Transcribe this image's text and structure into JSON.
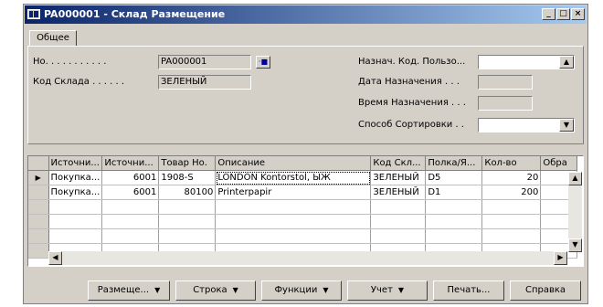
{
  "window": {
    "title": "PA000001 - Склад Размещение",
    "controls": [
      "_",
      "□",
      "×"
    ]
  },
  "tabs": [
    {
      "label": "Общее",
      "active": true
    }
  ],
  "form": {
    "no_label": "Но. . . . . . . . . . .",
    "no_value": "PA000001",
    "location_label": "Код Склада . . . . . .",
    "location_value": "ЗЕЛЕНЫЙ",
    "assigned_user_label": "Назнач. Код. Пользо...",
    "assigned_user_value": "",
    "assignment_date_label": "Дата Назначения . . .",
    "assignment_date_value": "",
    "assignment_time_label": "Время Назначения . . .",
    "assignment_time_value": "",
    "sorting_method_label": "Способ Сортировки . .",
    "sorting_method_value": ""
  },
  "lines": {
    "columns": [
      "Источни...",
      "Источни...",
      "Товар Но.",
      "Описание",
      "Код Скл...",
      "Полка/Я...",
      "Кол-во",
      "Обра"
    ],
    "rows": [
      [
        "Покупка...",
        "6001",
        "1908-S",
        "LONDON Kontorstol, ЫЖ",
        "ЗЕЛЕНЫЙ",
        "D5",
        "20",
        ""
      ],
      [
        "Покупка...",
        "6001",
        "80100",
        "Printerpapir",
        "ЗЕЛЕНЫЙ",
        "D1",
        "200",
        ""
      ]
    ],
    "empty_rows": 4
  },
  "buttons": {
    "placement": "Размеще...",
    "line": "Строка",
    "functions": "Функции",
    "register": "Учет",
    "print": "Печать...",
    "help": "Справка"
  },
  "colors": {
    "title_start": "#0a246a",
    "title_end": "#a6caf0",
    "face": "#d4d0c8"
  }
}
